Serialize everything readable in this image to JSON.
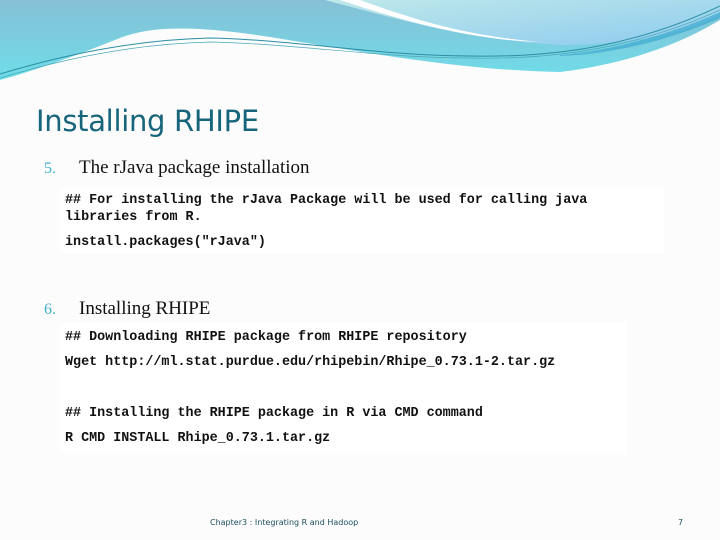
{
  "slide": {
    "title": "Installing RHIPE",
    "colors": {
      "title": "#17657b",
      "number": "#3fb1c6",
      "wave": "#7ec4d8"
    },
    "items": [
      {
        "number": "5.",
        "heading": "The rJava package installation",
        "code_lines": [
          "## For installing the rJava Package will be used for calling java",
          "libraries from R.",
          "install.packages(\"rJava\")"
        ]
      },
      {
        "number": "6.",
        "heading": "Installing RHIPE",
        "code_lines": [
          "## Downloading RHIPE package from RHIPE repository",
          "Wget http://ml.stat.purdue.edu/rhipebin/Rhipe_0.73.1-2.tar.gz",
          "## Installing the RHIPE package in R via CMD command",
          "R CMD INSTALL Rhipe_0.73.1.tar.gz"
        ]
      }
    ],
    "footer": "Chapter3 : Integrating R and Hadoop",
    "page_number": "7"
  }
}
